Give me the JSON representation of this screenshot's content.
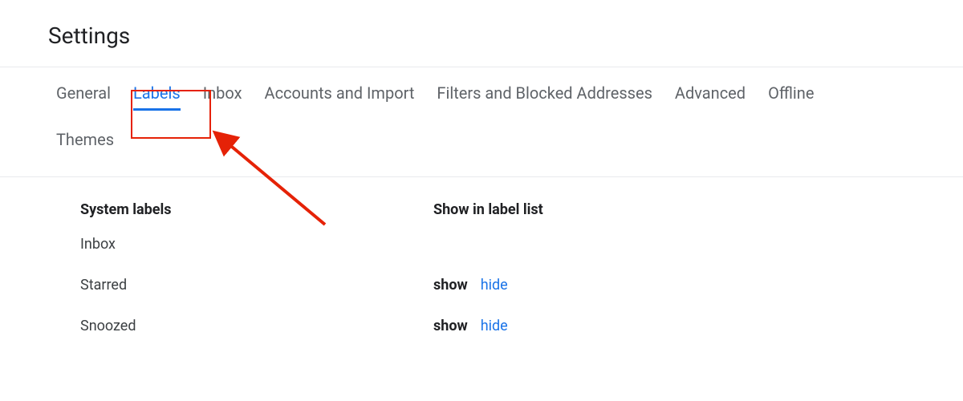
{
  "page": {
    "title": "Settings"
  },
  "tabs": {
    "general": "General",
    "labels": "Labels",
    "inbox": "Inbox",
    "accounts": "Accounts and Import",
    "filters": "Filters and Blocked Addresses",
    "advanced": "Advanced",
    "offline": "Offline",
    "themes": "Themes",
    "active": "labels"
  },
  "columns": {
    "system_labels": "System labels",
    "show_in_list": "Show in label list"
  },
  "rows": {
    "inbox": {
      "name": "Inbox"
    },
    "starred": {
      "name": "Starred",
      "show": "show",
      "hide": "hide"
    },
    "snoozed": {
      "name": "Snoozed",
      "show": "show",
      "hide": "hide"
    }
  },
  "annotation": {
    "color": "#e52207"
  }
}
